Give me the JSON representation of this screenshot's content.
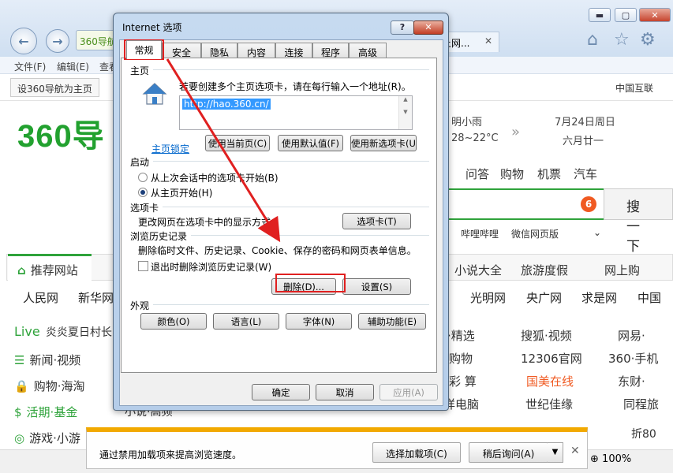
{
  "browser": {
    "addr_chip": "360导航",
    "tab_label": "上网...",
    "tab_close": "✕",
    "window_buttons": {
      "minimize": "▬",
      "maximize": "▢",
      "close": "✕"
    },
    "menu": [
      "文件(F)",
      "编辑(E)",
      "查看"
    ],
    "fav_button": "设360导航为主页",
    "fav_right": "中国互联",
    "logo": "360导",
    "weather": {
      "city": "明小雨",
      "temp": "28~22°C",
      "date": "7月24日周日",
      "lunar": "六月廿一",
      "chevrons": "»"
    },
    "site_nav": [
      "问答",
      "购物",
      "机票",
      "汽车"
    ],
    "search_badge": "6",
    "search_button": "搜一下",
    "quick_links": [
      "哔哩哔哩",
      "微信网页版",
      "⌄"
    ],
    "rec_tab": {
      "label": "推荐网站",
      "icon": "⌂"
    },
    "rec_extra": [
      "小说大全",
      "旅游度假",
      "网上购"
    ],
    "site_row": [
      "人民网",
      "新华网",
      "光明网",
      "央广网",
      "求是网",
      "中国"
    ],
    "live_label": "Live",
    "live_text": "炎炎夏日村长",
    "side_items": [
      {
        "icon": "☰",
        "label": "新闻·视频"
      },
      {
        "icon": "🔒",
        "label": "购物·海淘"
      },
      {
        "icon": "$",
        "label": "活期·基金"
      },
      {
        "icon": "◎",
        "label": "游戏·小游"
      }
    ],
    "grid": [
      {
        "text": "·精选"
      },
      {
        "text": "搜狐·视频"
      },
      {
        "text": "网易·"
      },
      {
        "text": "购物"
      },
      {
        "text": "12306官网"
      },
      {
        "text": "360·手机"
      },
      {
        "text": "彩 算"
      },
      {
        "text": "国美在线"
      },
      {
        "text": "东财·"
      },
      {
        "text": "详电脑"
      },
      {
        "text": "世纪佳缘"
      },
      {
        "text": "同程旅"
      }
    ],
    "side_overlap": [
      "小说·高频"
    ],
    "bottom_right": "折80",
    "zoom": "100%"
  },
  "notification": {
    "text": "通过禁用加载项来提高浏览速度。",
    "btn_choose": "选择加载项(C)",
    "btn_later": "稍后询问(A)",
    "dropdown": "▼",
    "close": "✕"
  },
  "dialog": {
    "title": "Internet 选项",
    "help": "?",
    "close": "✕",
    "tabs": [
      "常规",
      "安全",
      "隐私",
      "内容",
      "连接",
      "程序",
      "高级"
    ],
    "homepage": {
      "section": "主页",
      "desc": "若要创建多个主页选项卡，请在每行输入一个地址(R)。",
      "url": "http://hao.360.cn/",
      "locked_link": "主页锁定",
      "btn_current": "使用当前页(C)",
      "btn_default": "使用默认值(F)",
      "btn_new_tab": "使用新选项卡(U)"
    },
    "startup": {
      "section": "启动",
      "option_last": "从上次会话中的选项卡开始(B)",
      "option_home": "从主页开始(H)"
    },
    "tabs_section": {
      "section": "选项卡",
      "desc": "更改网页在选项卡中的显示方式。",
      "btn": "选项卡(T)"
    },
    "history": {
      "section": "浏览历史记录",
      "desc": "删除临时文件、历史记录、Cookie、保存的密码和网页表单信息。",
      "checkbox": "退出时删除浏览历史记录(W)",
      "btn_delete": "删除(D)...",
      "btn_settings": "设置(S)"
    },
    "appearance": {
      "section": "外观",
      "btn_colors": "颜色(O)",
      "btn_language": "语言(L)",
      "btn_fonts": "字体(N)",
      "btn_accessibility": "辅助功能(E)"
    },
    "footer": {
      "ok": "确定",
      "cancel": "取消",
      "apply": "应用(A)"
    }
  },
  "annotation_color": "#e02020"
}
